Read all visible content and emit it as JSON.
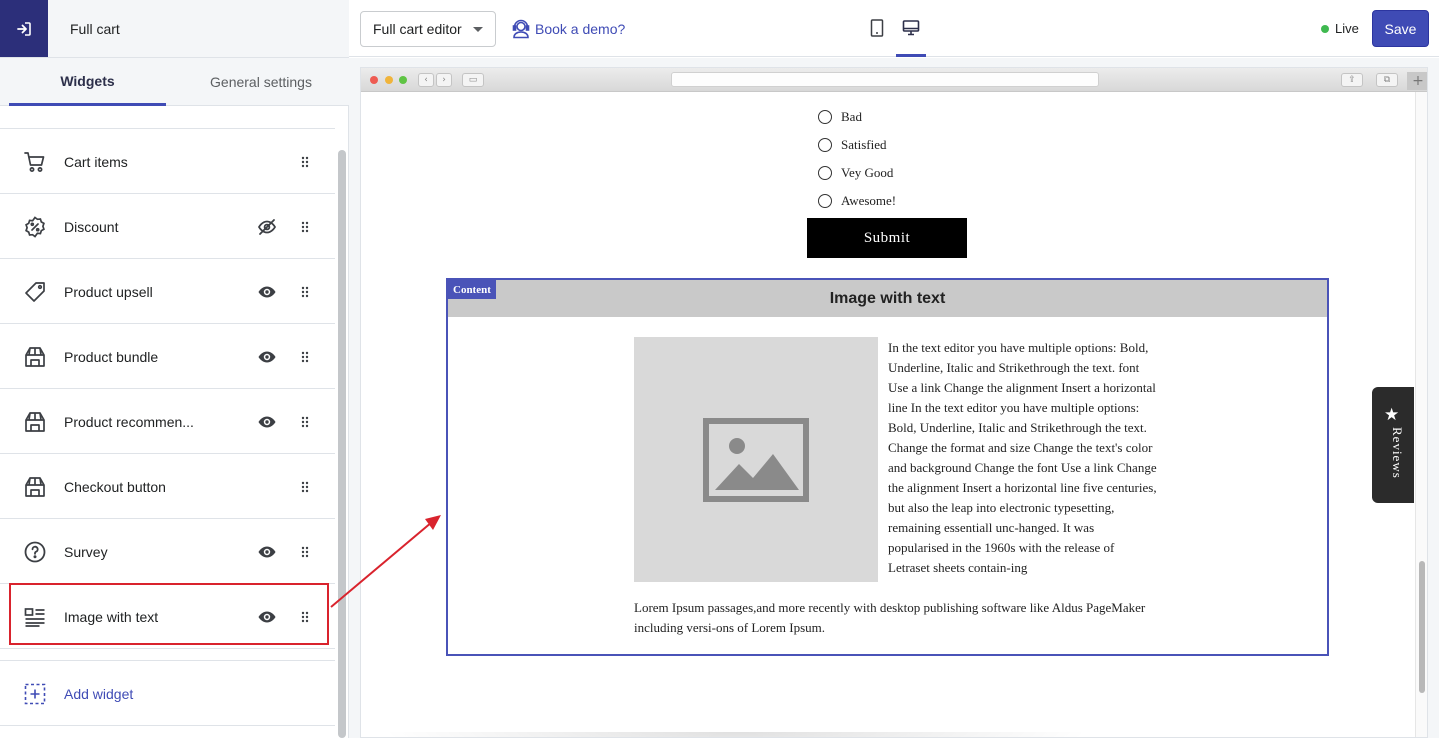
{
  "left_panel": {
    "title": "Full cart",
    "tabs": [
      {
        "label": "Widgets",
        "active": true
      },
      {
        "label": "General settings",
        "active": false
      }
    ],
    "widgets": [
      {
        "label": "Cart items",
        "icon": "cart-icon",
        "visibility": "none"
      },
      {
        "label": "Discount",
        "icon": "discount-icon",
        "visibility": "hidden"
      },
      {
        "label": "Product upsell",
        "icon": "tag-icon",
        "visibility": "visible"
      },
      {
        "label": "Product bundle",
        "icon": "shop-icon",
        "visibility": "visible"
      },
      {
        "label": "Product recommen...",
        "icon": "shop-icon",
        "visibility": "visible"
      },
      {
        "label": "Checkout button",
        "icon": "shop-icon",
        "visibility": "none"
      },
      {
        "label": "Survey",
        "icon": "question-icon",
        "visibility": "visible"
      },
      {
        "label": "Image with text",
        "icon": "image-text-icon",
        "visibility": "visible",
        "highlighted": true
      }
    ],
    "add_widget": "Add widget"
  },
  "topbar": {
    "editor_select": "Full cart editor",
    "demo_link": "Book a demo?",
    "devices": [
      "mobile-icon",
      "desktop-icon"
    ],
    "active_device": "desktop",
    "status": "Live",
    "save_label": "Save"
  },
  "preview": {
    "survey_options": [
      "Bad",
      "Satisfied",
      "Vey Good",
      "Awesome!"
    ],
    "submit_label": "Submit",
    "content_badge": "Content",
    "block_title": "Image with text",
    "body_text_right": "In the text editor you have multiple options: Bold, Underline, Italic and Strikethrough the text. font Use a link Change the alignment Insert a horizontal line In the text editor you have multiple options: Bold, Underline, Italic and Strikethrough the text. Change the format and size Change the text's color and background Change the font Use a link Change the alignment Insert a horizontal line five centuries, but also the leap into electronic typesetting, remaining essentiall unc-hanged. It was popularised in the 1960s with the release of Letraset sheets contain-ing",
    "body_text_bottom": "Lorem Ipsum passages,and more recently with desktop publishing software like Aldus PageMaker including versi-ons of Lorem Ipsum.",
    "reviews_tab": "Reviews"
  },
  "colors": {
    "accent": "#3f4bb5",
    "back_button": "#2c2f7a",
    "highlight": "#d9232d",
    "live": "#3fb950"
  }
}
